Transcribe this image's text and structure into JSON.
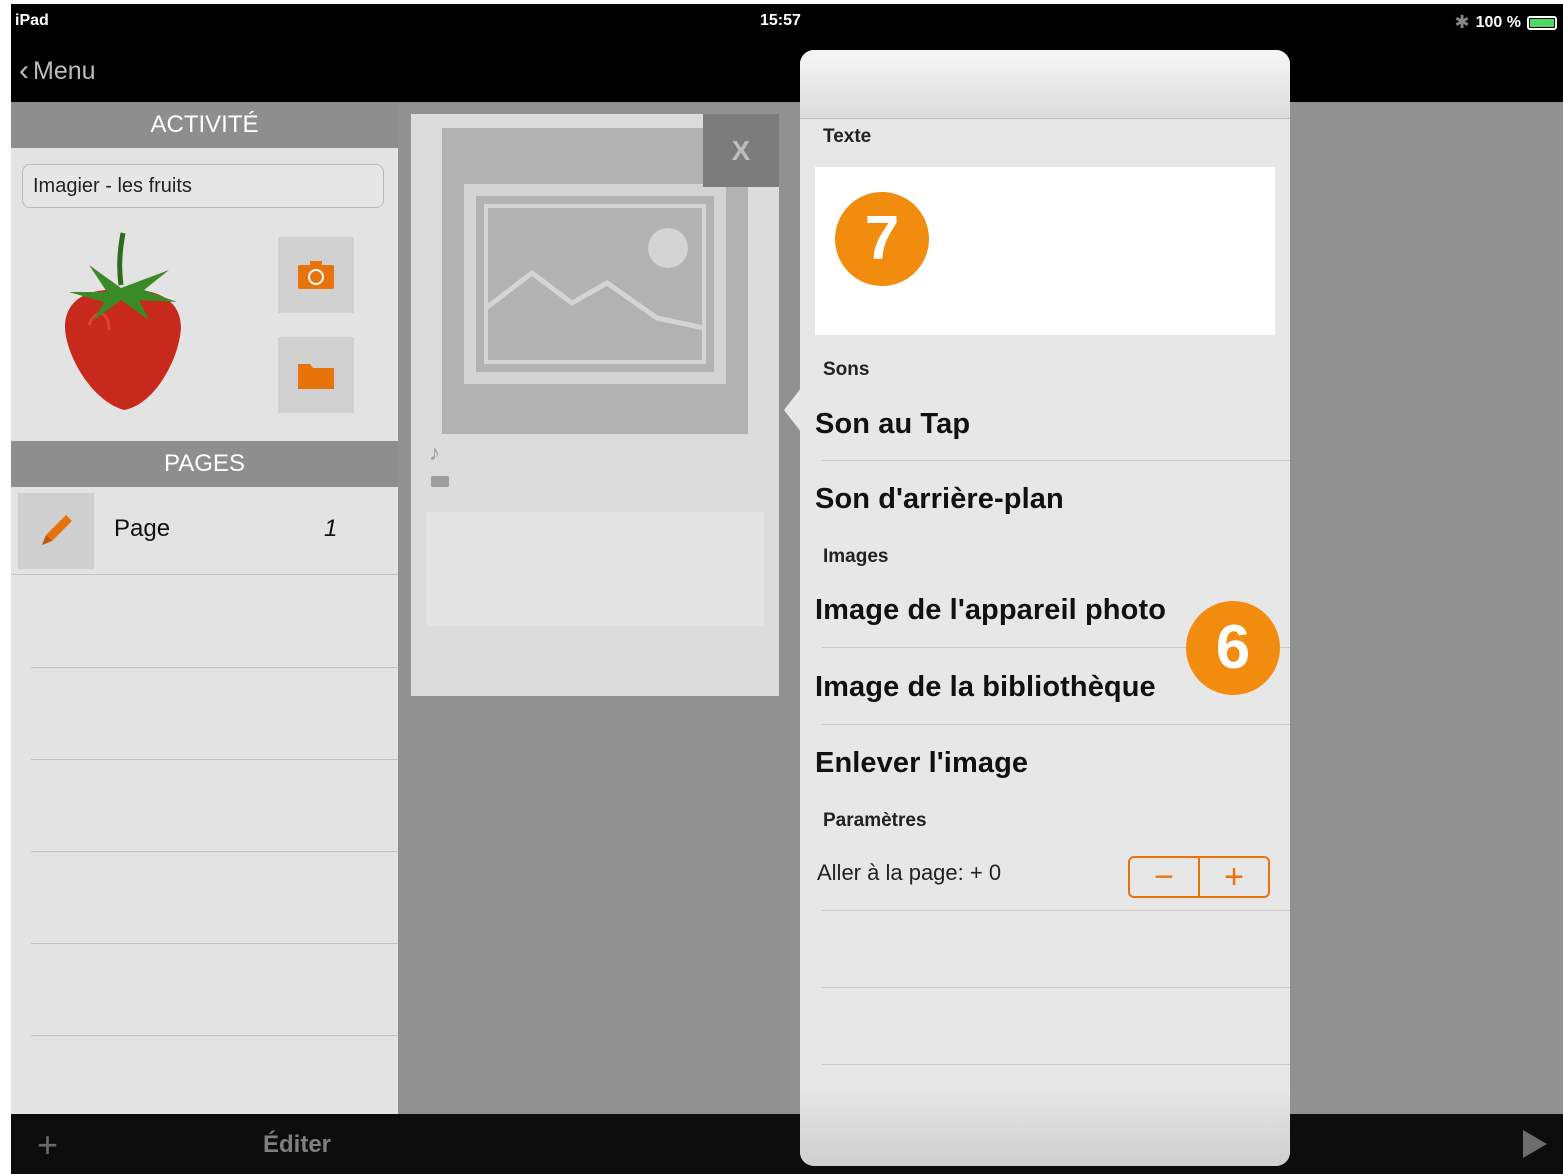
{
  "status": {
    "carrier": "iPad",
    "time": "15:57",
    "battery": "100 %"
  },
  "nav": {
    "back_label": "Menu"
  },
  "sidebar": {
    "activity_header": "ACTIVITÉ",
    "activity_name": "Imagier - les fruits",
    "pages_header": "PAGES",
    "pages": [
      {
        "label": "Page",
        "number": "1"
      }
    ]
  },
  "toolbar": {
    "edit_label": "Éditer"
  },
  "preview": {
    "close_label": "X"
  },
  "popover": {
    "sections": {
      "text": "Texte",
      "sounds": "Sons",
      "images": "Images",
      "settings": "Paramètres"
    },
    "sound_items": [
      "Son au Tap",
      "Son d'arrière-plan"
    ],
    "image_items": [
      "Image de l'appareil photo",
      "Image de la bibliothèque",
      "Enlever l'image"
    ],
    "goto_page_label": "Aller à la page: + 0",
    "stepper": {
      "minus": "−",
      "plus": "+"
    }
  },
  "badges": {
    "text_badge": "7",
    "image_badge": "6"
  },
  "colors": {
    "accent": "#e8730a",
    "badge": "#f28c0f"
  }
}
